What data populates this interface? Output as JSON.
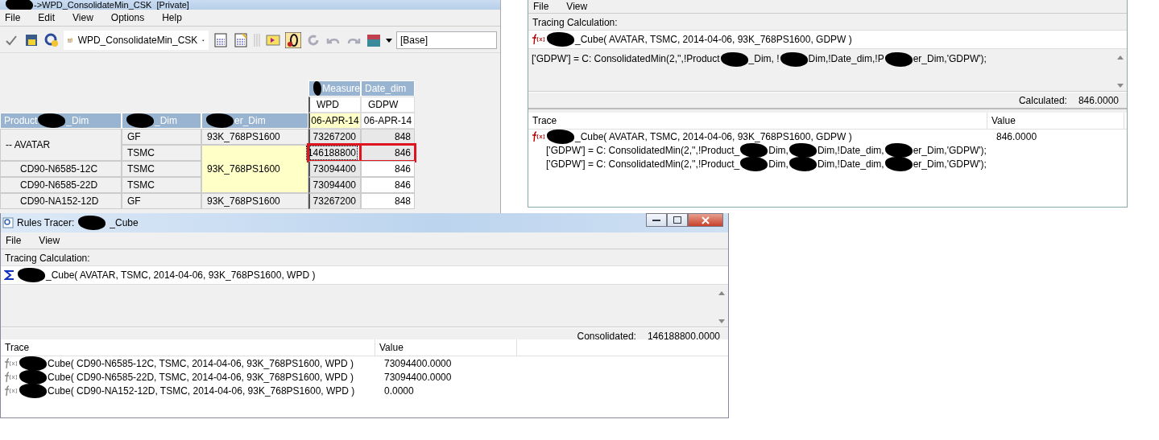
{
  "main_window": {
    "title": {
      "lead_redacted": true,
      "parts": [
        "->WPD_ConsolidateMin_CSK  [Private]"
      ]
    },
    "menu": [
      "File",
      "Edit",
      "View",
      "Options",
      "Help"
    ],
    "toolbar": {
      "view_name": "WPD_ConsolidateMin_CSK",
      "subset": "[Base]"
    },
    "column_dims": [
      {
        "lead_redacted": true,
        "parts": [
          "Measure"
        ]
      },
      {
        "lead_redacted": false,
        "parts": [
          "Date_dim"
        ]
      }
    ],
    "row_dims": [
      {
        "lead_redacted": false,
        "parts": [
          "Product",
          "_Dim"
        ]
      },
      {
        "lead_redacted": true,
        "parts": [
          "_Dim"
        ]
      },
      {
        "lead_redacted": true,
        "parts": [
          "er_Dim"
        ]
      }
    ],
    "columns": [
      {
        "measure": "WPD",
        "date": "06-APR-14",
        "date_highlighted": true
      },
      {
        "measure": "GDPW",
        "date": "06-APR-14",
        "date_highlighted": false
      }
    ],
    "rows": [
      {
        "product": "-- AVATAR",
        "site": "GF",
        "tech": "93K_768PS1600",
        "tech_highlighted": false,
        "values": [
          {
            "text": "73267200",
            "consolidated": true,
            "flagged": false,
            "focused": false
          },
          {
            "text": "848",
            "consolidated": true,
            "flagged": false,
            "focused": false
          }
        ]
      },
      {
        "site": "TSMC",
        "tech": "93K_768PS1600",
        "tech_highlighted": true,
        "values": [
          {
            "text": "146188800",
            "consolidated": true,
            "flagged": true,
            "focused": true
          },
          {
            "text": "846",
            "consolidated": true,
            "flagged": true,
            "focused": false
          }
        ]
      },
      {
        "product": "CD90-N6585-12C",
        "site": "TSMC",
        "values": [
          {
            "text": "73094400",
            "consolidated": true,
            "flagged": false,
            "focused": false
          },
          {
            "text": "846",
            "consolidated": false,
            "flagged": false,
            "focused": false
          }
        ]
      },
      {
        "product": "CD90-N6585-22D",
        "site": "TSMC",
        "values": [
          {
            "text": "73094400",
            "consolidated": true,
            "flagged": false,
            "focused": false
          },
          {
            "text": "846",
            "consolidated": false,
            "flagged": false,
            "focused": false
          }
        ]
      },
      {
        "product": "CD90-NA152-12D",
        "site": "GF",
        "tech": "93K_768PS1600",
        "tech_highlighted": false,
        "values": [
          {
            "text": "73267200",
            "consolidated": true,
            "flagged": false,
            "focused": false
          },
          {
            "text": "848",
            "consolidated": false,
            "flagged": false,
            "focused": false
          }
        ]
      }
    ]
  },
  "tracer_right": {
    "menu": [
      "File",
      "View"
    ],
    "tracing_label": "Tracing Calculation:",
    "calculation": {
      "kind": "function",
      "lead_redacted": true,
      "parts": [
        "_Cube( AVATAR, TSMC, 2014-04-06, 93K_768PS1600, GDPW )"
      ]
    },
    "rule": {
      "lead_redacted": false,
      "parts": [
        "['GDPW'] = C: ConsolidatedMin(2,'',!Product",
        "_Dim, !",
        "Dim,!Date_dim,!P",
        "er_Dim,'GDPW');"
      ]
    },
    "result": {
      "label": "Calculated:",
      "value": "846.0000"
    },
    "trace_columns": [
      "Trace",
      "Value"
    ],
    "trace": [
      {
        "kind": "function",
        "lead_redacted": true,
        "parts": [
          "_Cube( AVATAR, TSMC, 2014-04-06, 93K_768PS1600, GDPW )"
        ],
        "value": "846.0000",
        "children": [
          {
            "kind": "rule",
            "lead_redacted": false,
            "parts": [
              "['GDPW'] = C: ConsolidatedMin(2,'',!Product_",
              "Dim,",
              "Dim,!Date_dim,",
              "er_Dim,'GDPW');"
            ]
          },
          {
            "kind": "rule",
            "lead_redacted": false,
            "parts": [
              "['GDPW'] = C: ConsolidatedMin(2,'',!Product_",
              "Dim,",
              "Dim,!Date_dim,",
              "er_Dim,'GDPW');"
            ]
          }
        ]
      }
    ]
  },
  "tracer_bottom": {
    "title": {
      "lead_redacted": false,
      "parts": [
        "Rules Tracer:",
        "_Cube"
      ]
    },
    "menu": [
      "File",
      "View"
    ],
    "tracing_label": "Tracing Calculation:",
    "calculation": {
      "kind": "sum",
      "lead_redacted": true,
      "parts": [
        "_Cube( AVATAR, TSMC, 2014-04-06, 93K_768PS1600, WPD )"
      ]
    },
    "result": {
      "label": "Consolidated:",
      "value": "146188800.0000"
    },
    "trace_columns": [
      "Trace",
      "Value"
    ],
    "trace": [
      {
        "kind": "function",
        "lead_redacted": true,
        "parts": [
          "Cube( CD90-N6585-12C, TSMC, 2014-04-06, 93K_768PS1600, WPD )"
        ],
        "value": "73094400.0000"
      },
      {
        "kind": "function",
        "lead_redacted": true,
        "parts": [
          "Cube( CD90-N6585-22D, TSMC, 2014-04-06, 93K_768PS1600, WPD )"
        ],
        "value": "73094400.0000"
      },
      {
        "kind": "function",
        "lead_redacted": true,
        "parts": [
          "Cube( CD90-NA152-12D, TSMC, 2014-04-06, 93K_768PS1600, WPD )"
        ],
        "value": "0.0000"
      }
    ]
  }
}
